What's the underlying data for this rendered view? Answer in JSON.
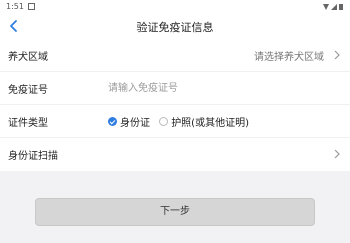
{
  "status_bar": {
    "time": "1:51"
  },
  "nav": {
    "title": "验证免疫证信息"
  },
  "form": {
    "area": {
      "label": "养犬区域",
      "value": "请选择养犬区域"
    },
    "cert_no": {
      "label": "免疫证号",
      "placeholder": "请输入免疫证号",
      "value": ""
    },
    "id_type": {
      "label": "证件类型",
      "options": [
        {
          "label": "身份证",
          "selected": true
        },
        {
          "label": "护照(或其他证明)",
          "selected": false
        }
      ]
    },
    "id_scan": {
      "label": "身份证扫描"
    }
  },
  "next_button": {
    "label": "下一步"
  },
  "colors": {
    "accent": "#2f7de1",
    "button_bg": "#d6d6d6",
    "page_bg": "#f2f2f4"
  }
}
